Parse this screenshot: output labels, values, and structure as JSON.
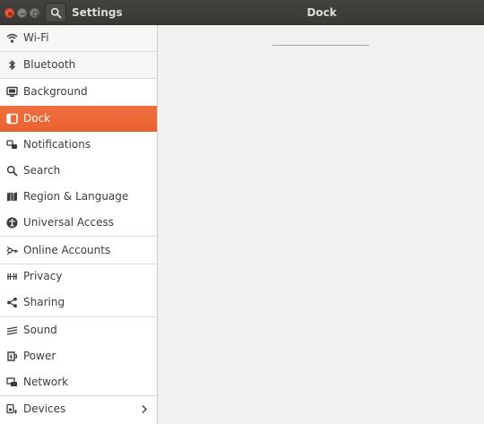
{
  "window": {
    "app_title": "Settings",
    "panel_title": "Dock"
  },
  "header": {
    "close_icon": "close-icon",
    "minimize_icon": "minimize-icon",
    "maximize_icon": "maximize-icon",
    "search_icon": "search-icon"
  },
  "sidebar": {
    "items": [
      {
        "label": "Wi-Fi",
        "icon": "wifi-icon"
      },
      {
        "label": "Bluetooth",
        "icon": "bluetooth-icon"
      },
      {
        "label": "Background",
        "icon": "background-icon"
      },
      {
        "label": "Dock",
        "icon": "dock-icon",
        "selected": true
      },
      {
        "label": "Notifications",
        "icon": "notifications-icon"
      },
      {
        "label": "Search",
        "icon": "search-icon"
      },
      {
        "label": "Region & Language",
        "icon": "region-icon"
      },
      {
        "label": "Universal Access",
        "icon": "universal-access-icon"
      },
      {
        "label": "Online Accounts",
        "icon": "online-accounts-icon"
      },
      {
        "label": "Privacy",
        "icon": "privacy-icon"
      },
      {
        "label": "Sharing",
        "icon": "sharing-icon"
      },
      {
        "label": "Sound",
        "icon": "sound-icon"
      },
      {
        "label": "Power",
        "icon": "power-icon"
      },
      {
        "label": "Network",
        "icon": "network-icon"
      },
      {
        "label": "Devices",
        "icon": "devices-icon",
        "has_submenu": true
      }
    ]
  },
  "colors": {
    "accent": "#e95420",
    "headerbar": "#3c3b37",
    "content_bg": "#f2f1f0"
  }
}
